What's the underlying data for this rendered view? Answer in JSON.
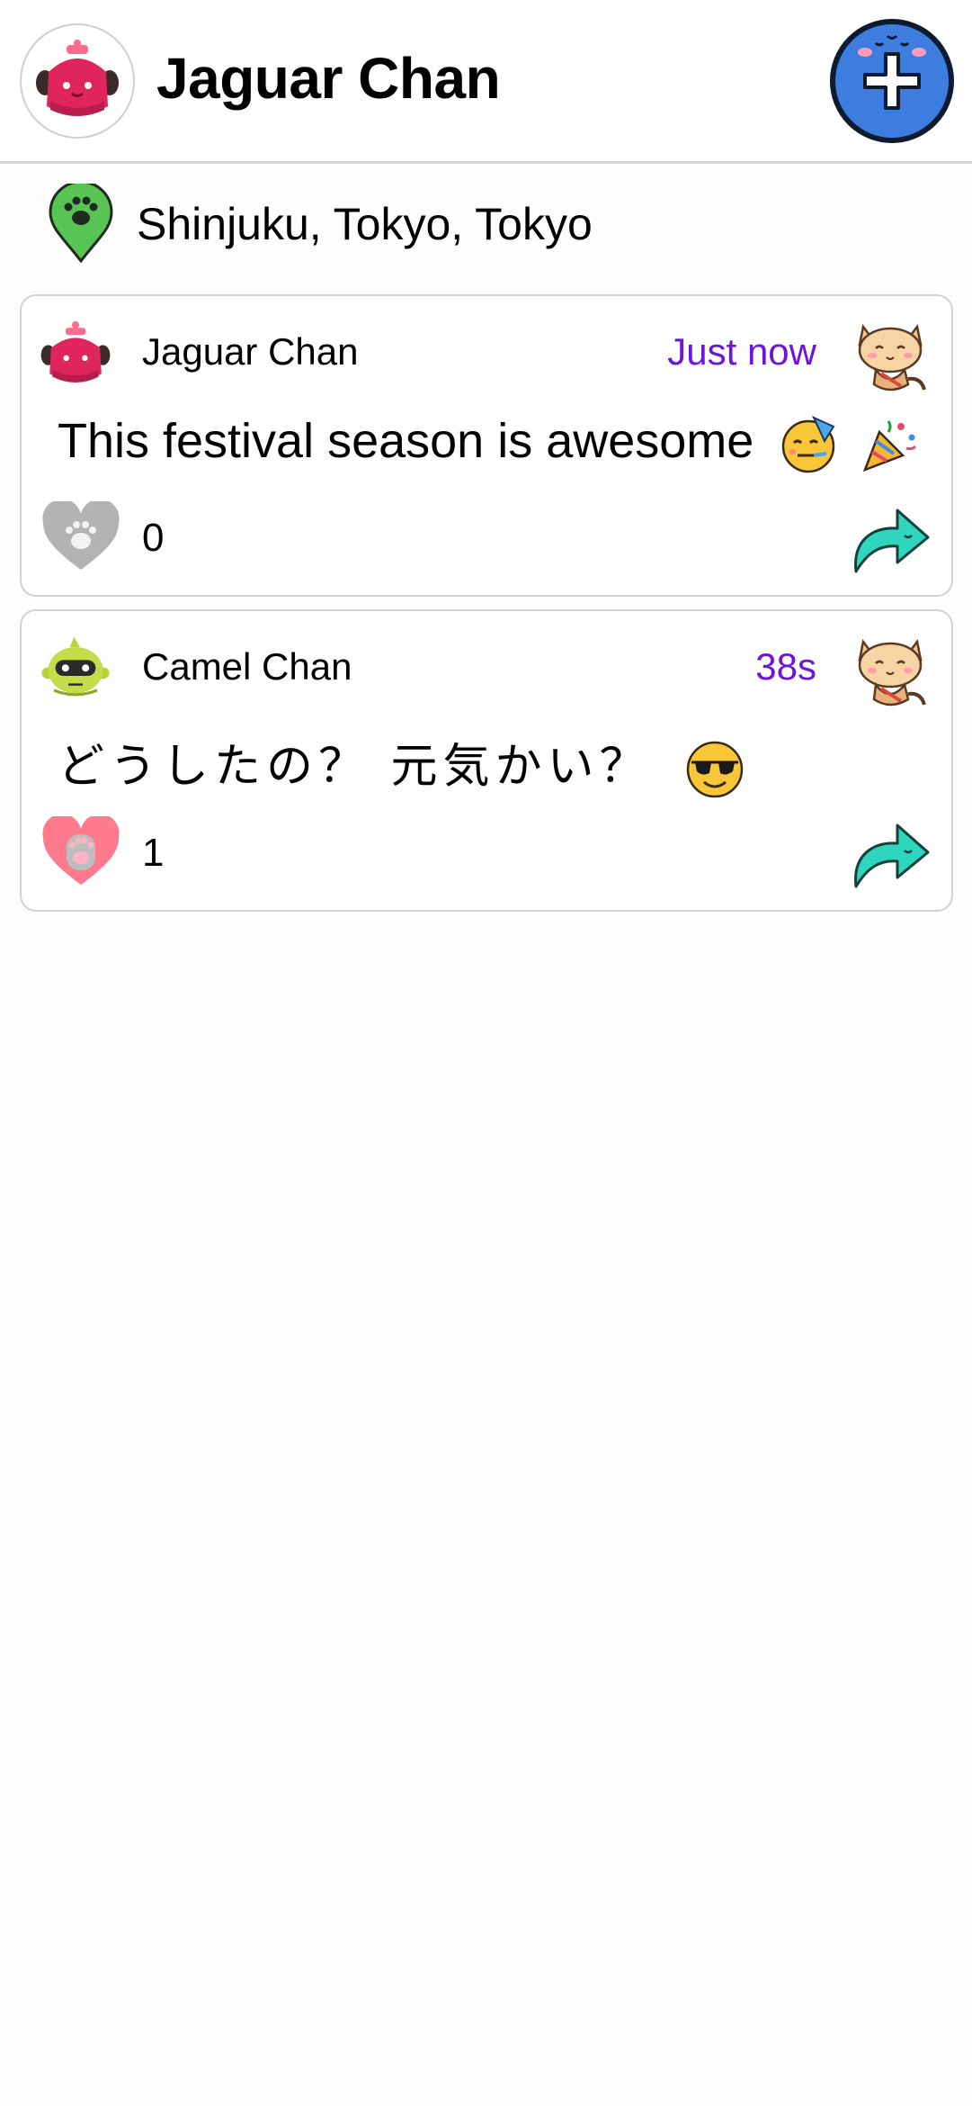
{
  "header": {
    "title": "Jaguar Chan",
    "avatar_icon": "jaguar-avatar-icon",
    "add_icon": "add-plus-icon"
  },
  "location": {
    "text": "Shinjuku, Tokyo, Tokyo",
    "icon": "map-pin-paw-icon"
  },
  "posts": [
    {
      "author": "Jaguar Chan",
      "time": "Just now",
      "body": "This festival season is awesome",
      "emojis": [
        "party-face-icon",
        "party-popper-icon"
      ],
      "likes": "0",
      "liked": false,
      "avatar_icon": "jaguar-avatar-icon",
      "sticker_icon": "cat-sticker-icon"
    },
    {
      "author": "Camel Chan",
      "time": "38s",
      "body": "どうしたの？ 元気かい？",
      "emojis": [
        "sunglasses-face-icon"
      ],
      "likes": "1",
      "liked": true,
      "avatar_icon": "camel-avatar-icon",
      "sticker_icon": "cat-sticker-icon"
    }
  ],
  "colors": {
    "accent_time": "#6e16d8",
    "add_button": "#3d7de0",
    "pin": "#57c453",
    "share": "#2fd6be",
    "heart_liked": "#ff7a8c",
    "heart_unliked": "#b3b3b3"
  }
}
